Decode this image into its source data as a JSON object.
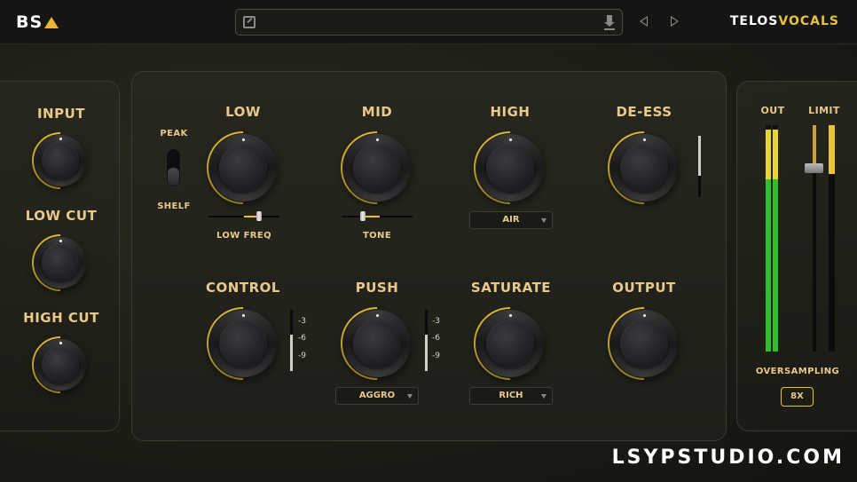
{
  "header": {
    "logo_text": "BS",
    "brand_part1": "TELOS",
    "brand_part2": "VOCALS",
    "preset_name": ""
  },
  "left": {
    "input_label": "INPUT",
    "low_cut_label": "LOW CUT",
    "high_cut_label": "HIGH CUT"
  },
  "eq": {
    "peak_label": "PEAK",
    "shelf_label": "SHELF",
    "low_label": "LOW",
    "mid_label": "MID",
    "high_label": "HIGH",
    "deess_label": "DE-ESS",
    "low_freq_label": "LOW FREQ",
    "tone_label": "TONE",
    "air_option": "AIR"
  },
  "dynamics": {
    "control_label": "CONTROL",
    "push_label": "PUSH",
    "saturate_label": "SATURATE",
    "output_label": "OUTPUT",
    "push_mode": "AGGRO",
    "saturate_mode": "RICH",
    "scale_marks": [
      "-3",
      "-6",
      "-9"
    ]
  },
  "right": {
    "out_label": "OUT",
    "limit_label": "LIMIT",
    "oversampling_label": "OVERSAMPLING",
    "oversampling_value": "8X"
  },
  "watermark": "LSYPSTUDIO.COM",
  "colors": {
    "accent": "#e8c23a",
    "label": "#e9c98b",
    "meter_green": "#2fbf2f",
    "meter_yellow": "#e8d531"
  }
}
